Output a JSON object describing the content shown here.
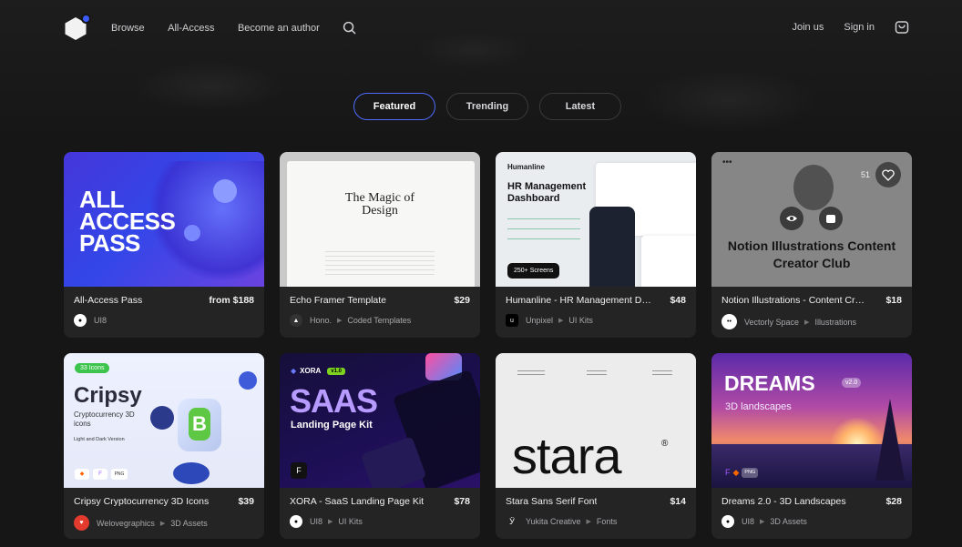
{
  "nav": {
    "links": [
      "Browse",
      "All-Access",
      "Become an author"
    ],
    "right": [
      "Join us",
      "Sign in"
    ]
  },
  "tabs": [
    "Featured",
    "Trending",
    "Latest"
  ],
  "colors": {
    "accent": "#4f6cff",
    "logo_dot": "#3b5bfd",
    "background": "#161616",
    "card": "#242424"
  },
  "cards": [
    {
      "title": "All-Access Pass",
      "price": "from $188",
      "author": "UI8",
      "category": "",
      "thumb": {
        "line1": "ALL",
        "line2": "ACCESS",
        "line3": "PASS"
      }
    },
    {
      "title": "Echo Framer Template",
      "price": "$29",
      "author": "Hono.",
      "category": "Coded Templates",
      "thumb": {
        "heading": "The Magic of Design"
      }
    },
    {
      "title": "Humanline - HR Management Da...",
      "price": "$48",
      "author": "Unpixel",
      "category": "UI Kits",
      "thumb": {
        "brand": "Humanline",
        "heading": "HR Management Dashboard",
        "badge": "250+ Screens"
      }
    },
    {
      "title": "Notion Illustrations - Content Crea...",
      "price": "$18",
      "author": "Vectorly Space",
      "category": "Illustrations",
      "thumb": {
        "heading": "Notion Illustrations Content Creator Club",
        "likes": "51"
      }
    },
    {
      "title": "Cripsy Cryptocurrency 3D Icons",
      "price": "$39",
      "author": "Welovegraphics",
      "category": "3D Assets",
      "thumb": {
        "badge": "33 Icons",
        "heading": "Cripsy",
        "sub": "Cryptocurrency 3D icons",
        "note": "Light and Dark Version"
      }
    },
    {
      "title": "XORA - SaaS Landing Page Kit",
      "price": "$78",
      "author": "UI8",
      "category": "UI Kits",
      "thumb": {
        "brand": "XORA",
        "version": "v1.0",
        "heading": "SAAS",
        "sub": "Landing Page Kit"
      }
    },
    {
      "title": "Stara Sans Serif Font",
      "price": "$14",
      "author": "Yukita Creative",
      "category": "Fonts",
      "thumb": {
        "heading": "stara"
      }
    },
    {
      "title": "Dreams 2.0 - 3D Landscapes",
      "price": "$28",
      "author": "UI8",
      "category": "3D Assets",
      "thumb": {
        "heading": "DREAMS",
        "version": "v2.0",
        "sub": "3D landscapes"
      }
    }
  ]
}
